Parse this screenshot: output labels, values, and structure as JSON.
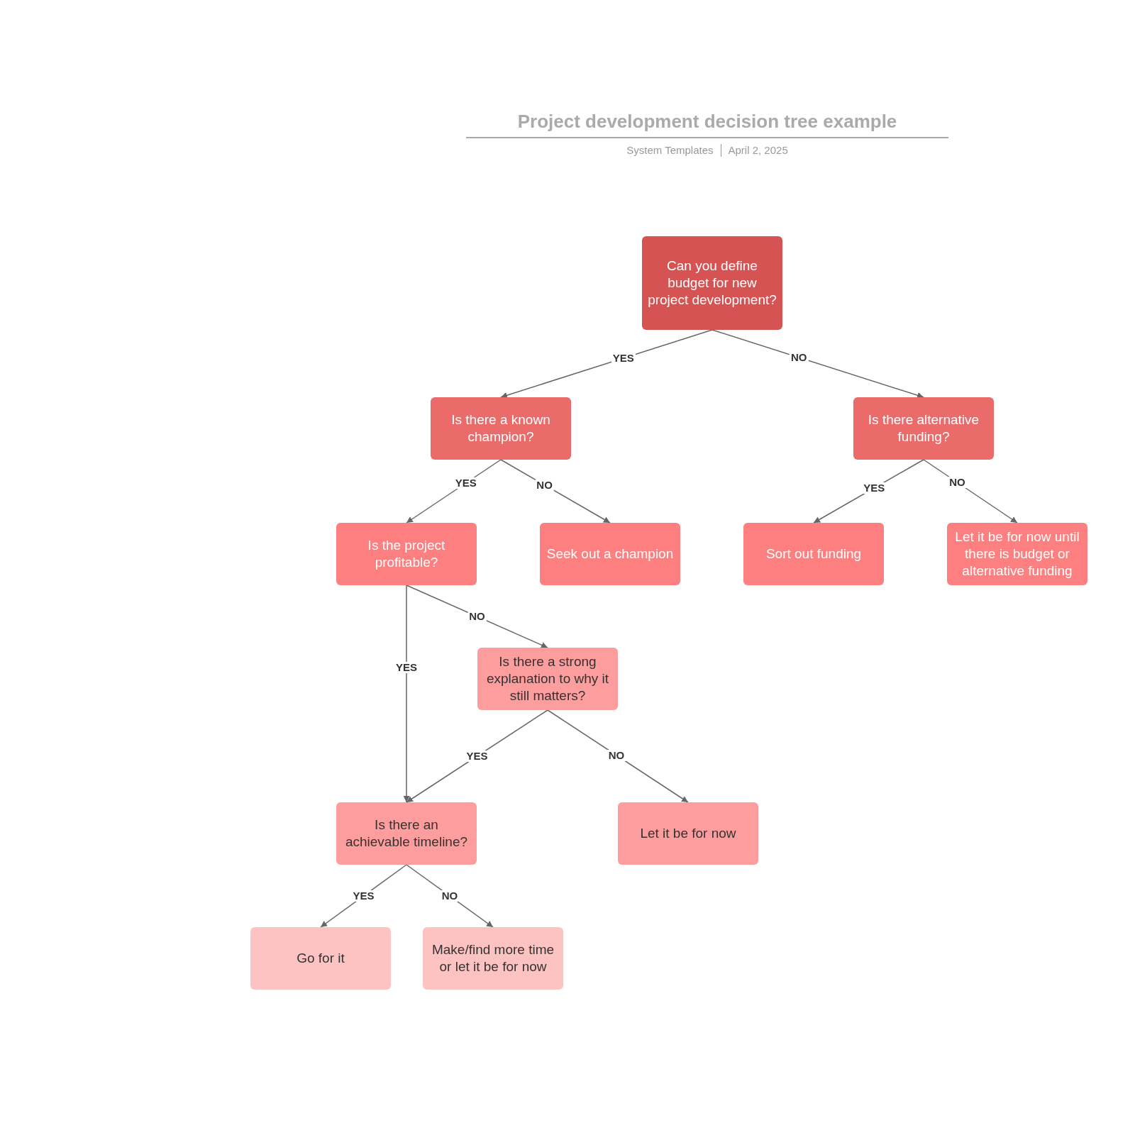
{
  "header": {
    "title": "Project development decision tree example",
    "author": "System Templates",
    "date": "April 2, 2025"
  },
  "nodes": [
    {
      "text": "Can you define budget for new project development?",
      "color": "#d65353"
    },
    {
      "text": "Is there a known champion?",
      "color": "#eb6b6b"
    },
    {
      "text": "Is there alternative funding?",
      "color": "#eb6b6b"
    },
    {
      "text": "Is the project profitable?",
      "color": "#fd7f7f"
    },
    {
      "text": "Seek out a champion",
      "color": "#fd7f7f"
    },
    {
      "text": "Sort out funding",
      "color": "#fd7f7f"
    },
    {
      "text": "Let it be for now until there is budget or alternative funding",
      "color": "#fd7f7f"
    },
    {
      "text": "Is there a strong explanation to why it still matters?",
      "color": "#fd9d9d"
    },
    {
      "text": "Is there an achievable timeline?",
      "color": "#fd9d9d"
    },
    {
      "text": "Let it be for now",
      "color": "#fd9d9d"
    },
    {
      "text": "Go for it",
      "color": "#fdc3c3"
    },
    {
      "text": "Make/find more time or let it be for now",
      "color": "#fdc3c3"
    }
  ],
  "connectors": [
    {
      "label": "YES"
    },
    {
      "label": "NO"
    },
    {
      "label": "YES"
    },
    {
      "label": "NO"
    },
    {
      "label": "YES"
    },
    {
      "label": "NO"
    },
    {
      "label": "YES"
    },
    {
      "label": "NO"
    },
    {
      "label": "YES"
    },
    {
      "label": "NO"
    },
    {
      "label": "YES"
    },
    {
      "label": "NO"
    }
  ]
}
